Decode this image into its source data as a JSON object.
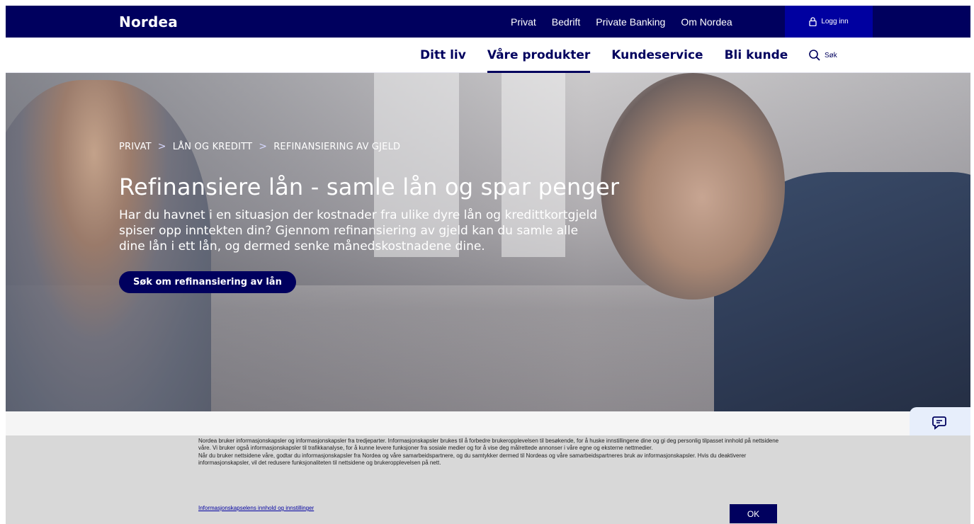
{
  "brand": {
    "logo_text": "Nordea"
  },
  "topnav": {
    "items": [
      "Privat",
      "Bedrift",
      "Private Banking",
      "Om Nordea"
    ],
    "login_label": "Logg inn"
  },
  "mainnav": {
    "items": [
      "Ditt liv",
      "Våre produkter",
      "Kundeservice",
      "Bli kunde"
    ],
    "active": "Våre produkter",
    "search_label": "Søk"
  },
  "hero": {
    "breadcrumb": [
      "PRIVAT",
      "LÅN OG KREDITT",
      "REFINANSIERING AV GJELD"
    ],
    "title": "Refinansiere lån - samle lån og spar penger",
    "body": "Har du havnet i en situasjon der kostnader fra ulike dyre lån og kredittkortgjeld spiser opp inntekten din? Gjennom refinansiering av gjeld kan du samle alle dine lån i ett lån, og dermed senke månedskostnadene dine.",
    "cta_label": "Søk om refinansiering av lån"
  },
  "cookie": {
    "text1": "Nordea bruker informasjonskapsler og informasjonskapsler fra tredjeparter. Informasjonskapsler brukes til å forbedre brukeropplevelsen til besøkende, for å huske innstillingene dine og gi deg personlig tilpasset innhold på nettsidene våre. Vi bruker også informasjonskapsler til trafikkanalyse, for å kunne levere funksjoner fra sosiale medier og for å vise deg målrettede annonser i våre egne og eksterne nettmedier.",
    "text2": "Når du bruker nettsidene våre, godtar du informasjonskapsler fra Nordea og våre samarbeidspartnere, og du samtykker dermed til Nordeas og våre samarbeidspartneres bruk av informasjonskapsler. Hvis du deaktiverer informasjonskapsler, vil det redusere funksjonaliteten til nettsidene og brukeropplevelsen på nett.",
    "link_label": "Informasjonskapselens innhold og innstillinger",
    "ok_label": "OK"
  },
  "colors": {
    "brand_navy": "#00005e",
    "login_blue": "#0000a0",
    "cookie_bg": "#d8d8d8",
    "chat_bg": "#e7eefb"
  },
  "icons": {
    "login": "lock-icon",
    "search": "search-icon",
    "chat": "chat-bubble-icon",
    "breadcrumb_sep": "chevron-right-icon"
  }
}
